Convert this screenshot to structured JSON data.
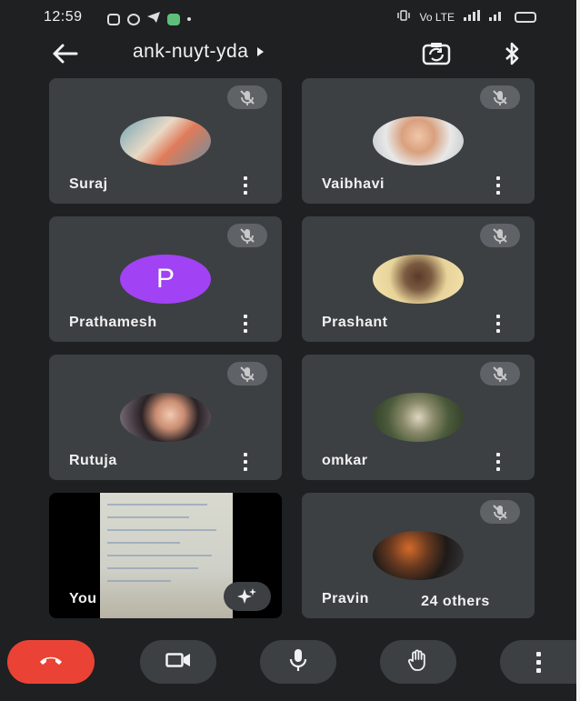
{
  "status_bar": {
    "time": "12:59",
    "right_text": "Vo LTE"
  },
  "app_bar": {
    "meeting_code": "ank-nuyt-yda"
  },
  "participants": [
    {
      "name": "Suraj",
      "avatar_letter": ""
    },
    {
      "name": "Vaibhavi",
      "avatar_letter": ""
    },
    {
      "name": "Prathamesh",
      "avatar_letter": "P"
    },
    {
      "name": "Prashant",
      "avatar_letter": ""
    },
    {
      "name": "Rutuja",
      "avatar_letter": ""
    },
    {
      "name": "omkar",
      "avatar_letter": ""
    },
    {
      "name": "You",
      "avatar_letter": ""
    },
    {
      "name": "Pravin",
      "avatar_letter": ""
    }
  ],
  "others_chip": "24 others",
  "icons": {
    "back": "arrow-left-icon",
    "caret": "caret-right-icon",
    "switch_camera": "camera-switch-icon",
    "bluetooth": "bluetooth-icon",
    "mute": "mic-off-icon",
    "more": "more-vert-icon",
    "effects": "sparkle-icon",
    "end_call": "phone-hangup-icon",
    "camera": "video-camera-icon",
    "mic": "mic-icon",
    "raise_hand": "hand-icon"
  },
  "colors": {
    "background": "#1f2022",
    "tile": "#3c4043",
    "end_call": "#ea4335",
    "avatar_purple": "#a142f4"
  }
}
